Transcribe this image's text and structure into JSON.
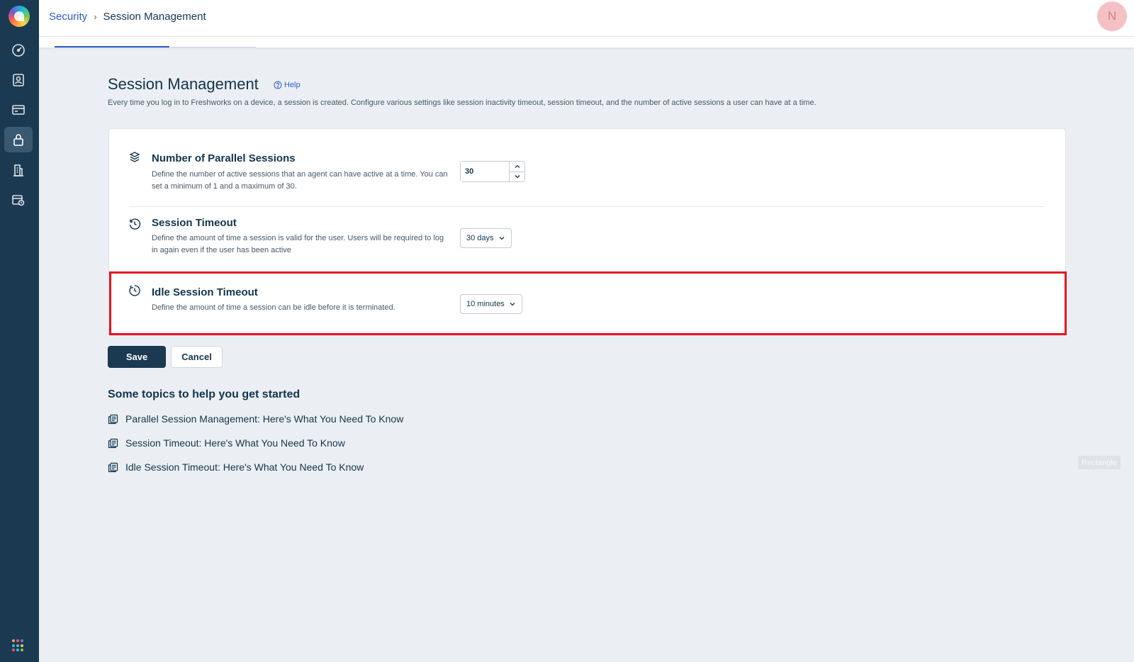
{
  "header": {
    "breadcrumb": {
      "parent": "Security",
      "separator": "›",
      "current": "Session Management"
    },
    "avatar_initial": "N"
  },
  "sidebar": {
    "items": [
      {
        "icon": "speedometer-icon"
      },
      {
        "icon": "contact-card-icon"
      },
      {
        "icon": "credit-card-icon"
      },
      {
        "icon": "lock-icon",
        "active": true
      },
      {
        "icon": "building-icon"
      },
      {
        "icon": "calendar-clock-icon"
      }
    ],
    "apps_icon": "apps-grid-icon"
  },
  "page": {
    "title": "Session Management",
    "help_label": "Help",
    "description": "Every time you log in to Freshworks on a device, a session is created. Configure various settings like session inactivity timeout, session timeout, and the number of active sessions a user can have at a time."
  },
  "settings": {
    "parallel_sessions": {
      "title": "Number of Parallel Sessions",
      "description": "Define the number of active sessions that an agent can have active at a time. You can set a minimum of 1 and a maximum of 30.",
      "value": "30",
      "icon": "layers-icon"
    },
    "session_timeout": {
      "title": "Session Timeout",
      "description": "Define the amount of time a session is valid for the user. Users will be required to log in again even if the user has been active",
      "selected": "30 days",
      "icon": "history-clock-icon"
    },
    "idle_timeout": {
      "title": "Idle Session Timeout",
      "description": "Define the amount of time a session can be idle before it is terminated.",
      "selected": "10 minutes",
      "icon": "idle-clock-icon"
    }
  },
  "actions": {
    "save_label": "Save",
    "cancel_label": "Cancel"
  },
  "topics": {
    "title": "Some topics to help you get started",
    "items": [
      "Parallel Session Management: Here's What You Need To Know",
      "Session Timeout: Here's What You Need To Know",
      "Idle Session Timeout: Here's What You Need To Know"
    ]
  },
  "overlay_label": "Rectangle",
  "colors": {
    "sidebar": "#1b3a52",
    "link": "#2c5cc5",
    "highlight": "#e8121f",
    "primary_button": "#1b3a52"
  }
}
